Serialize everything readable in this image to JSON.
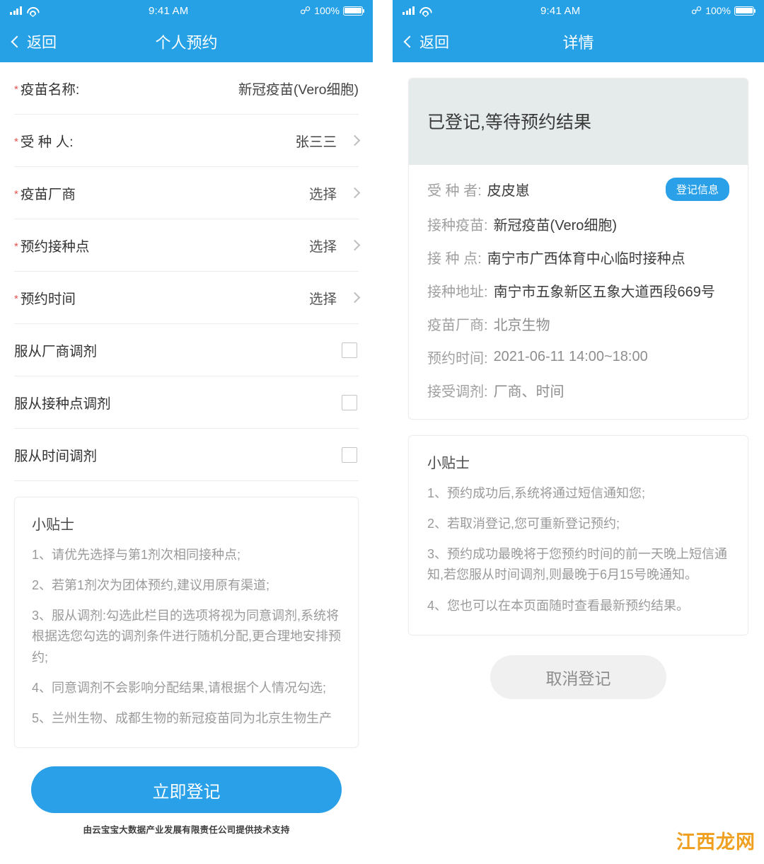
{
  "status_bar": {
    "time": "9:41 AM",
    "battery_percent": "100%"
  },
  "left_screen": {
    "nav": {
      "back_label": "返回",
      "title": "个人预约"
    },
    "form_rows": [
      {
        "required": true,
        "label": "疫苗名称:",
        "value": "新冠疫苗(Vero细胞)",
        "chevron": false,
        "type": "text"
      },
      {
        "required": true,
        "label": "受 种 人:",
        "value": "张三三",
        "chevron": true,
        "type": "select"
      },
      {
        "required": true,
        "label": "疫苗厂商",
        "value": "选择",
        "chevron": true,
        "type": "select"
      },
      {
        "required": true,
        "label": "预约接种点",
        "value": "选择",
        "chevron": true,
        "type": "select"
      },
      {
        "required": true,
        "label": "预约时间",
        "value": "选择",
        "chevron": true,
        "type": "select"
      }
    ],
    "checkbox_rows": [
      {
        "label": "服从厂商调剂",
        "checked": false
      },
      {
        "label": "服从接种点调剂",
        "checked": false
      },
      {
        "label": "服从时间调剂",
        "checked": false
      }
    ],
    "tips": {
      "title": "小贴士",
      "items": [
        "1、请优先选择与第1剂次相同接种点;",
        "2、若第1剂次为团体预约,建议用原有渠道;",
        "3、服从调剂:勾选此栏目的选项将视为同意调剂,系统将根据选您勾选的调剂条件进行随机分配,更合理地安排预约;",
        "4、同意调剂不会影响分配结果,请根据个人情况勾选;",
        "5、兰州生物、成都生物的新冠疫苗同为北京生物生产"
      ]
    },
    "submit_label": "立即登记",
    "footer_note": "由云宝宝大数据产业发展有限责任公司提供技术支持"
  },
  "right_screen": {
    "nav": {
      "back_label": "返回",
      "title": "详情"
    },
    "status_text": "已登记,等待预约结果",
    "badge_label": "登记信息",
    "detail_rows": [
      {
        "key": "受 种 者:",
        "value": "皮皮崽",
        "muted": false
      },
      {
        "key": "接种疫苗:",
        "value": "新冠疫苗(Vero细胞)",
        "muted": false
      },
      {
        "key": "接 种 点:",
        "value": "南宁市广西体育中心临时接种点",
        "muted": false
      },
      {
        "key": "接种地址:",
        "value": "南宁市五象新区五象大道西段669号",
        "muted": false
      },
      {
        "key": "疫苗厂商:",
        "value": "北京生物",
        "muted": true
      },
      {
        "key": "预约时间:",
        "value": "2021-06-11 14:00~18:00",
        "muted": true
      },
      {
        "key": "接受调剂:",
        "value": "厂商、时间",
        "muted": true
      }
    ],
    "tips": {
      "title": "小贴士",
      "items": [
        "1、预约成功后,系统将通过短信通知您;",
        "2、若取消登记,您可重新登记预约;",
        "3、预约成功最晚将于您预约时间的前一天晚上短信通知,若您服从时间调剂,则最晚于6月15号晚通知。",
        "4、您也可以在本页面随时查看最新预约结果。"
      ]
    },
    "cancel_label": "取消登记"
  },
  "watermark": "江西龙网",
  "colors": {
    "brand_blue": "#26a1e5",
    "button_blue": "#29a0e8",
    "required_red": "#e8534f",
    "status_band": "#e5eaea",
    "watermark_orange": "#f0a020"
  }
}
